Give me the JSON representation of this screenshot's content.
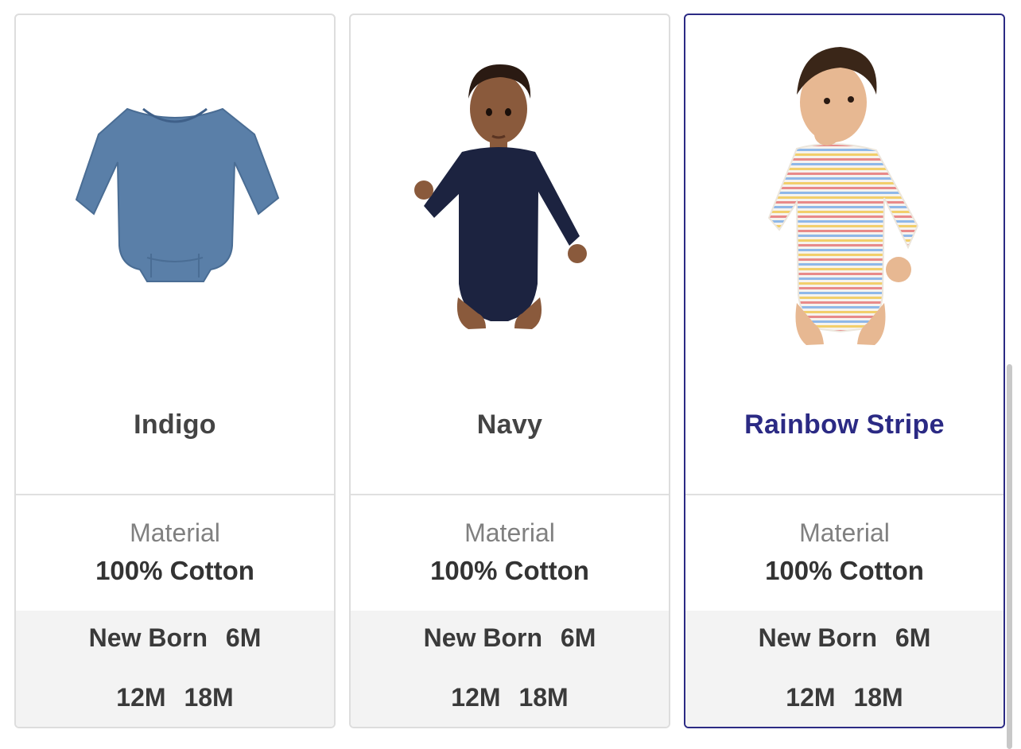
{
  "products": [
    {
      "name": "Indigo",
      "material_label": "Material",
      "material_value": "100% Cotton",
      "sizes": [
        "New Born",
        "6M",
        "12M",
        "18M"
      ],
      "selected": false,
      "color": "#5a7fa8"
    },
    {
      "name": "Navy",
      "material_label": "Material",
      "material_value": "100% Cotton",
      "sizes": [
        "New Born",
        "6M",
        "12M",
        "18M"
      ],
      "selected": false,
      "color": "#1c2340"
    },
    {
      "name": "Rainbow Stripe",
      "material_label": "Material",
      "material_value": "100% Cotton",
      "sizes": [
        "New Born",
        "6M",
        "12M",
        "18M"
      ],
      "selected": true,
      "color": "#f4f0ea"
    }
  ],
  "colors": {
    "selected_border": "#2b2a84",
    "card_border": "#dddddd",
    "size_bg": "#f3f3f3"
  }
}
